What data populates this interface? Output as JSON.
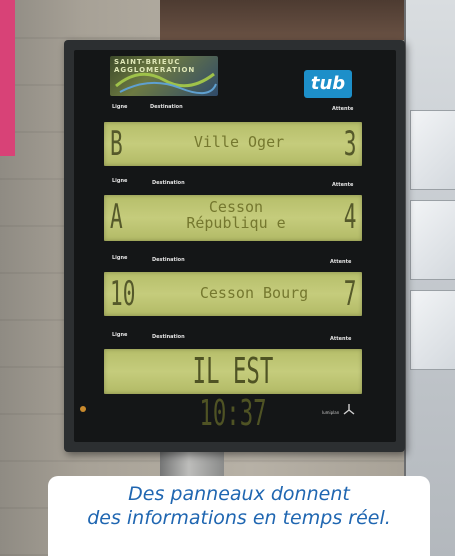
{
  "sign": {
    "logo_left_text": "SAINT-BRIEUC AGGLOMERATION",
    "logo_right": "tub",
    "rows": [
      {
        "col_ligne": "Ligne",
        "col_destination": "Destination",
        "col_attente": "Attente",
        "line": "B",
        "destination": "Ville Oger",
        "wait": "3"
      },
      {
        "col_ligne": "Ligne",
        "col_destination": "Destination",
        "col_attente": "Attente",
        "line": "A",
        "destination": "Cesson Républiqu e",
        "wait": "4"
      },
      {
        "col_ligne": "Ligne",
        "col_destination": "Destination",
        "col_attente": "Attente",
        "line": "10",
        "destination": "Cesson Bourg",
        "wait": "7"
      },
      {
        "col_ligne": "Ligne",
        "col_destination": "Destination",
        "col_attente": "Attente",
        "clock_text": "IL EST 10:37"
      }
    ],
    "maker_text": "lumiplan"
  },
  "caption": {
    "line1": "Des panneaux donnent",
    "line2": "des informations en temps réel."
  },
  "colors": {
    "lcd_background": "#bec573",
    "lcd_text": "#55592a",
    "caption_text": "#1f66b1",
    "accent_pink": "#d84277",
    "tub_blue": "#1d8fc9"
  }
}
